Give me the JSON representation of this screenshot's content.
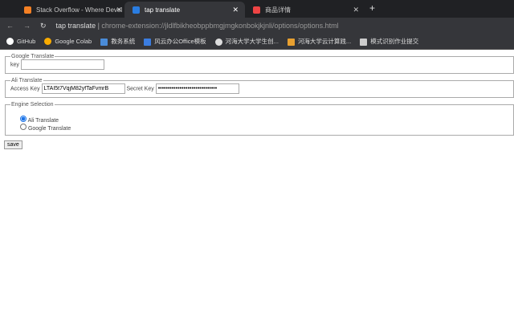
{
  "tabs": [
    {
      "title": "Stack Overflow - Where Devel"
    },
    {
      "title": "tap translate"
    },
    {
      "title": "商品详情"
    }
  ],
  "address": {
    "site": "tap translate",
    "url": "chrome-extension://jldlfbikheobppbmgjmgkonbokjkjnli/options/options.html"
  },
  "bookmarks": [
    "GitHub",
    "Google Colab",
    "教务系统",
    "风云办公Office模板",
    "河海大学大学生创...",
    "河海大学云计算践...",
    "模式识别作业提交"
  ],
  "google": {
    "legend": "Google Translate",
    "key_label": "key",
    "key_value": ""
  },
  "ali": {
    "legend": "Ali Translate",
    "access_label": "Access Key",
    "access_value": "LTAI5t7VqjM82yfTaFvmrB",
    "secret_label": "Secret Key",
    "secret_value": "••••••••••••••••••••••••••••••"
  },
  "engine": {
    "legend": "Engine Selection",
    "options": [
      "Ali Translate",
      "Google Translate"
    ],
    "selected": "Ali Translate"
  },
  "save_label": "save",
  "accent": "#1a73e8"
}
